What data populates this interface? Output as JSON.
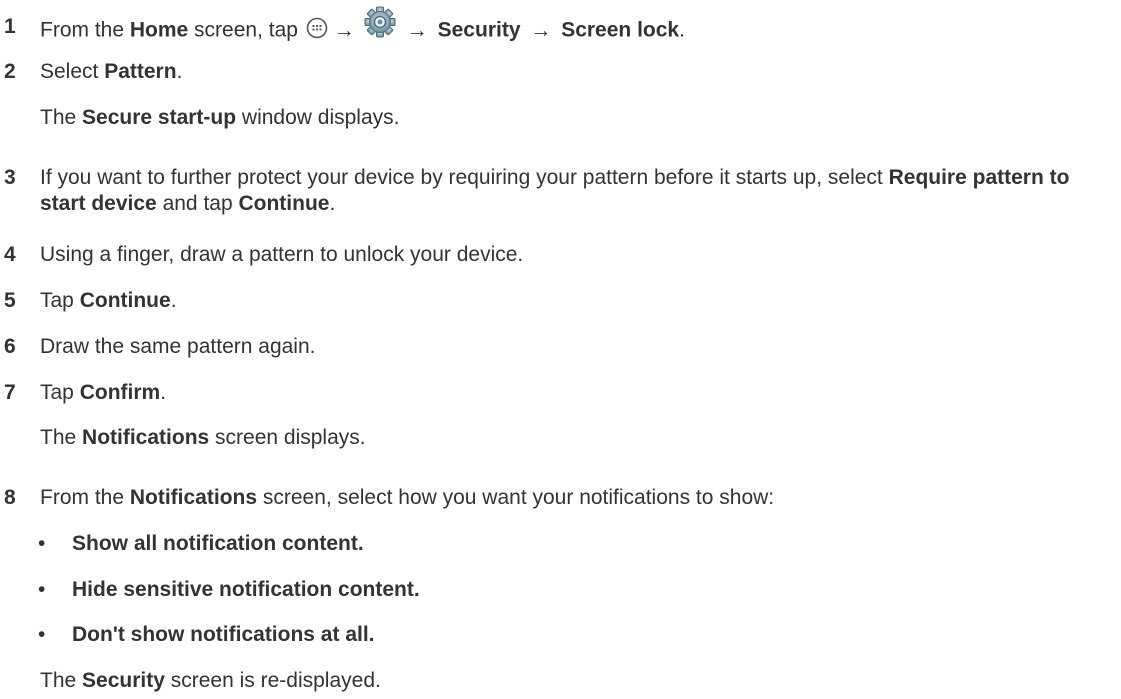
{
  "steps": [
    {
      "number": "1",
      "parts": {
        "a": "From the ",
        "b": "Home",
        "c": " screen, tap ",
        "arrow1": "→",
        "arrow2": "→",
        "d": "Security",
        "arrow3": "→",
        "e": "Screen lock",
        "f": "."
      }
    },
    {
      "number": "2",
      "parts": {
        "a": "Select ",
        "b": "Pattern",
        "c": "."
      },
      "note": {
        "a": "The ",
        "b": "Secure start-up",
        "c": " window displays."
      }
    },
    {
      "number": "3",
      "parts": {
        "a": "If you want to further protect your device by requiring your pattern before it starts up, select ",
        "b": "Require pattern to start device",
        "c": " and tap ",
        "d": "Continue",
        "e": "."
      }
    },
    {
      "number": "4",
      "parts": {
        "a": "Using a finger, draw a pattern to unlock your device."
      }
    },
    {
      "number": "5",
      "parts": {
        "a": "Tap ",
        "b": "Continue",
        "c": "."
      }
    },
    {
      "number": "6",
      "parts": {
        "a": "Draw the same pattern again."
      }
    },
    {
      "number": "7",
      "parts": {
        "a": "Tap ",
        "b": "Confirm",
        "c": "."
      },
      "note": {
        "a": "The ",
        "b": "Notifications",
        "c": " screen displays."
      }
    },
    {
      "number": "8",
      "parts": {
        "a": "From the ",
        "b": "Notifications",
        "c": " screen, select how you want your notifications to show:"
      },
      "bullet_glyph": "•",
      "bullets": [
        "Show all notification content.",
        "Hide sensitive notification content.",
        "Don't show notifications at all."
      ],
      "note": {
        "a": "The ",
        "b": "Security",
        "c": " screen is re-displayed."
      }
    }
  ],
  "icons": {
    "apps": "apps-grid-icon",
    "settings": "settings-gear-icon"
  }
}
